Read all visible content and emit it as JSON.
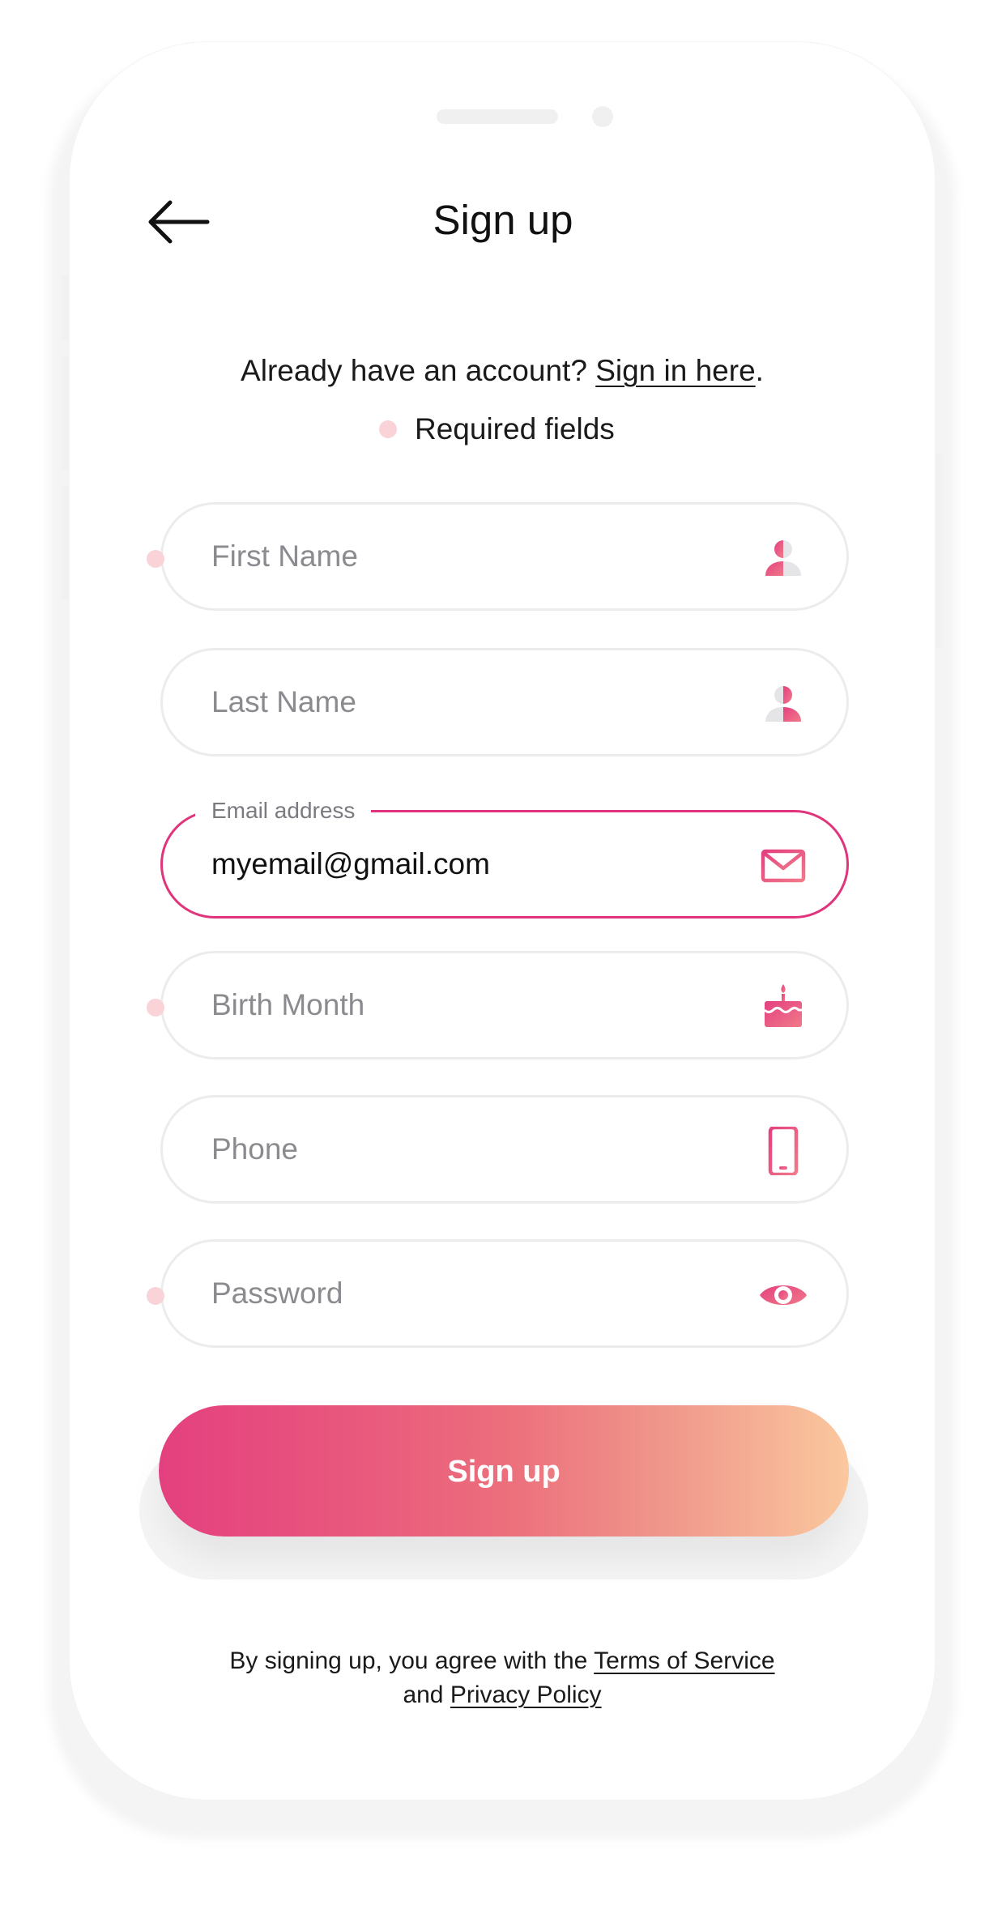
{
  "header": {
    "title": "Sign up",
    "back_icon": "arrow-left-icon"
  },
  "signin": {
    "prompt": "Already have an account?",
    "link": "Sign in here",
    "suffix": "."
  },
  "required_note": "Required fields",
  "fields": [
    {
      "placeholder": "First Name",
      "required": true,
      "icon": "person-icon"
    },
    {
      "placeholder": "Last Name",
      "required": false,
      "icon": "person-icon"
    },
    {
      "label": "Email address",
      "value": "myemail@gmail.com",
      "required": false,
      "icon": "envelope-icon",
      "focused": true
    },
    {
      "placeholder": "Birth Month",
      "required": true,
      "icon": "cake-icon"
    },
    {
      "placeholder": "Phone",
      "required": false,
      "icon": "phone-icon"
    },
    {
      "placeholder": "Password",
      "required": true,
      "icon": "eye-icon"
    }
  ],
  "submit_label": "Sign up",
  "terms": {
    "prefix": "By signing up, you agree with the",
    "tos_link": "Terms of  Service",
    "and": "and",
    "privacy_link": "Privacy Policy"
  },
  "colors": {
    "accent": "#e0357c",
    "gradient_start": "#e4407f",
    "gradient_end": "#fac89e",
    "required_dot": "#f9d3d8",
    "field_border": "#ececee"
  }
}
